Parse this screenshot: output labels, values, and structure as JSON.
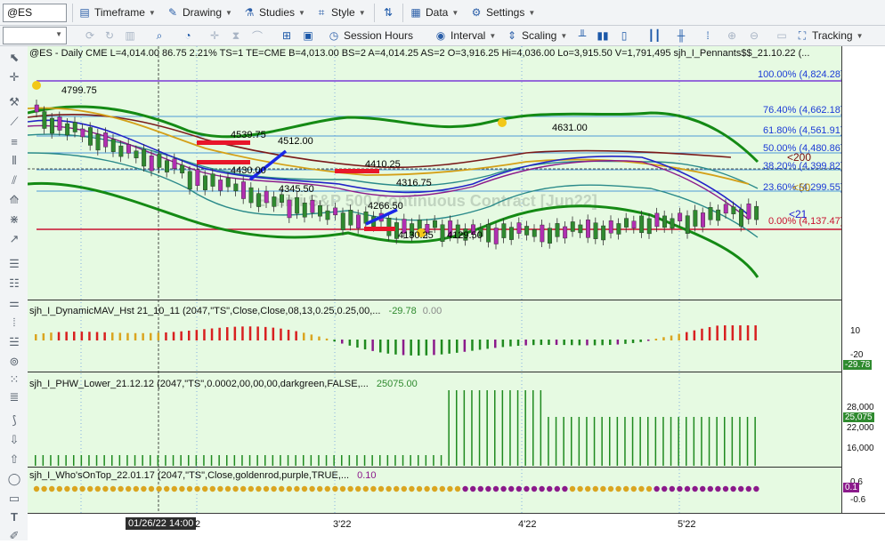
{
  "toolbar": {
    "symbol": "@ES",
    "timeframe": "Timeframe",
    "drawing": "Drawing",
    "studies": "Studies",
    "style": "Style",
    "data": "Data",
    "settings": "Settings",
    "session_hours": "Session Hours",
    "interval": "Interval",
    "scaling": "Scaling",
    "tracking": "Tracking"
  },
  "chart": {
    "header": "@ES - Daily  CME  L=4,014.00  86.75  2.21%  TS=1  TE=CME  B=4,013.00  BS=2  A=4,014.25  AS=2  O=3,916.25  Hi=4,036.00  Lo=3,915.50  V=1,791,495  sjh_I_Pennants$$_21.10.22 (...",
    "watermark": "E-mini S&P 500 Continuous Contract [Jun22]",
    "fib_levels": [
      {
        "label": "100.00% (4,824.28)",
        "color": "#1b3bd6"
      },
      {
        "label": "76.40% (4,662.18)",
        "color": "#1b3bd6"
      },
      {
        "label": "61.80% (4,561.91)",
        "color": "#1b3bd6"
      },
      {
        "label": "50.00% (4,480.86)",
        "color": "#1b3bd6"
      },
      {
        "label": "38.20% (4,399.82)",
        "color": "#1b3bd6"
      },
      {
        "label": "23.60% (4,299.55)",
        "color": "#1b3bd6"
      },
      {
        "label": "0.00% (4,137.47)",
        "color": "#c8102e"
      }
    ],
    "price_labels": [
      "4799.75",
      "4539.75",
      "4512.00",
      "4430.00",
      "4410.25",
      "4345.50",
      "4316.75",
      "4266.50",
      "4130.25",
      "4129.50",
      "4631.00"
    ],
    "side_labels": {
      "lt200": "<200",
      "lt50": "<50",
      "lt21": "<21"
    }
  },
  "panels": {
    "dynamic_mav": {
      "title": "sjh_I_DynamicMAV_Hst 21_10_11 (2047,\"TS\",Close,Close,08,13,0.25,0.25,00,...",
      "value1": "-29.78",
      "value2": "0.00",
      "ticks": [
        "10",
        "-20"
      ],
      "last": "-29.78"
    },
    "phw_lower": {
      "title": "sjh_I_PHW_Lower_21.12.12 (2047,\"TS\",0.0002,00,00,00,darkgreen,FALSE,...",
      "value": "25075.00",
      "ticks": [
        "28,000",
        "22,000",
        "16,000"
      ],
      "last": "25,075"
    },
    "whos_on_top": {
      "title": "sjh_I_Who'sOnTop_22.01.17 (2047,\"TS\",Close,goldenrod,purple,TRUE,...",
      "value": "0.10",
      "ticks": [
        "0.6",
        "-0.6"
      ],
      "last": "0.1"
    }
  },
  "xaxis": {
    "cursor_label": "01/26/22 14:00",
    "ticks": [
      "2",
      "3'22",
      "4'22",
      "5'22"
    ]
  },
  "colors": {
    "chart_bg": "#e6fae2",
    "fib_blue": "#1b3bd6",
    "zero_red": "#c8102e",
    "bull": "#2f8a2f",
    "bear": "#b12fb1",
    "gold": "#daa520",
    "purple": "#8b1a8b"
  }
}
